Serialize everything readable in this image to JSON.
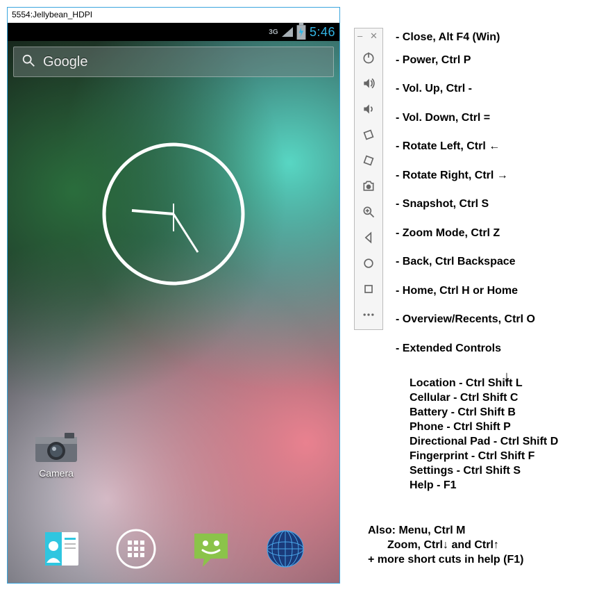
{
  "window": {
    "title": "5554:Jellybean_HDPI"
  },
  "status": {
    "network": "3G",
    "time": "5:46"
  },
  "search": {
    "placeholder": "Google"
  },
  "apps": {
    "camera_label": "Camera"
  },
  "toolbar": [
    {
      "name": "minimize",
      "label": "- Close, Alt F4 (Win)"
    },
    {
      "name": "power",
      "label": "- Power, Ctrl P"
    },
    {
      "name": "vol-up",
      "label": "- Vol. Up, Ctrl -"
    },
    {
      "name": "vol-down",
      "label": "- Vol. Down, Ctrl ="
    },
    {
      "name": "rotate-left",
      "label": "- Rotate Left, Ctrl ←"
    },
    {
      "name": "rotate-right",
      "label": "- Rotate Right, Ctrl →"
    },
    {
      "name": "snapshot",
      "label": "- Snapshot, Ctrl S"
    },
    {
      "name": "zoom",
      "label": "- Zoom Mode, Ctrl Z"
    },
    {
      "name": "back",
      "label": "- Back, Ctrl Backspace"
    },
    {
      "name": "home",
      "label": "- Home, Ctrl H or Home"
    },
    {
      "name": "overview",
      "label": "- Overview/Recents, Ctrl O"
    },
    {
      "name": "extended",
      "label": "- Extended Controls"
    }
  ],
  "extended": [
    "Location - Ctrl Shift L",
    "Cellular - Ctrl Shift C",
    "Battery - Ctrl Shift B",
    "Phone - Ctrl Shift P",
    "Directional  Pad - Ctrl Shift D",
    "Fingerprint - Ctrl Shift F",
    "Settings - Ctrl Shift S",
    "Help - F1"
  ],
  "also": {
    "line1": "Also: Menu, Ctrl M",
    "line2": "Zoom, Ctrl↓ and Ctrl↑",
    "line3": "+ more short cuts in help (F1)"
  }
}
